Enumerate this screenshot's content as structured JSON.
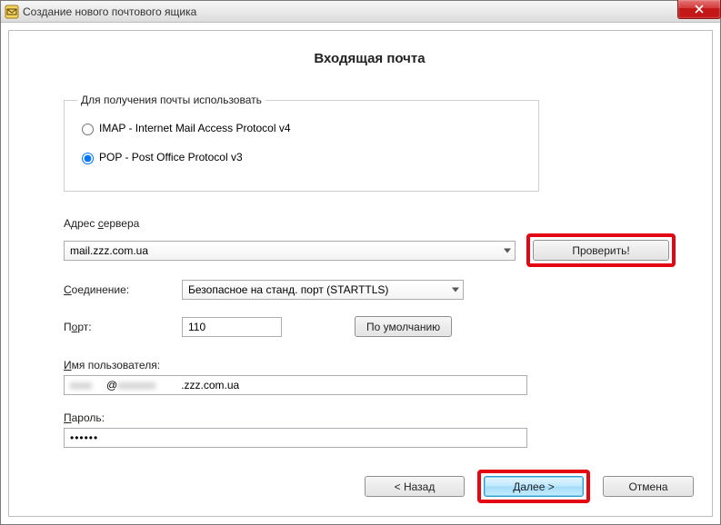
{
  "window": {
    "title": "Создание нового почтового ящика"
  },
  "page": {
    "heading": "Входящая почта"
  },
  "protocol": {
    "legend": "Для получения почты использовать",
    "imap_label": "IMAP - Internet Mail Access Protocol v4",
    "pop_label": "POP  -  Post Office Protocol v3",
    "selected": "pop"
  },
  "server": {
    "label_prefix": "Адрес ",
    "label_ul": "с",
    "label_suffix": "ервера",
    "value": "mail.zzz.com.ua",
    "check_button": "Проверить!"
  },
  "connection": {
    "label_ul": "С",
    "label_suffix": "оединение:",
    "value": "Безопасное на станд. порт (STARTTLS)"
  },
  "port": {
    "label_prefix": "П",
    "label_ul": "о",
    "label_suffix": "рт:",
    "value": "110",
    "default_button": "По умолчанию"
  },
  "username": {
    "label_ul": "И",
    "label_suffix": "мя пользователя:",
    "value_visible_prefix": "",
    "value_masked_middle": "@",
    "value_visible_suffix": ".zzz.com.ua"
  },
  "password": {
    "label_ul": "П",
    "label_suffix": "ароль:",
    "value_masked": "••••••"
  },
  "wizard": {
    "back": "<  Назад",
    "next": "Далее  >",
    "cancel": "Отмена"
  }
}
